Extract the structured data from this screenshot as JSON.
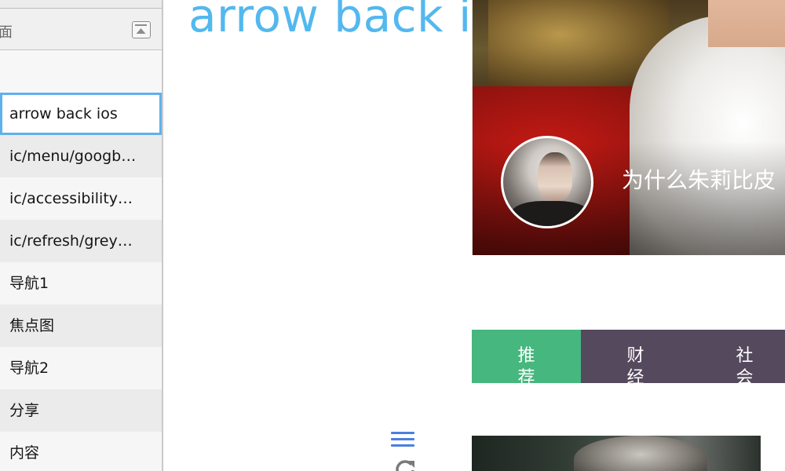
{
  "sidebar": {
    "group_label": "面",
    "layers": [
      {
        "label": "arrow back ios",
        "selected": true
      },
      {
        "label": "ic/menu/googb…",
        "selected": false
      },
      {
        "label": "ic/accessibility…",
        "selected": false
      },
      {
        "label": "ic/refresh/grey…",
        "selected": false
      },
      {
        "label": "导航1",
        "selected": false
      },
      {
        "label": "焦点图",
        "selected": false
      },
      {
        "label": "导航2",
        "selected": false
      },
      {
        "label": "分享",
        "selected": false
      },
      {
        "label": "内容",
        "selected": false
      }
    ]
  },
  "canvas": {
    "artboard_title": "arrow back ios",
    "hero": {
      "title": "为什么朱莉比皮"
    },
    "tabs": [
      {
        "label": "推荐",
        "active": true
      },
      {
        "label": "财经",
        "active": false
      },
      {
        "label": "社会",
        "active": false
      }
    ]
  },
  "colors": {
    "accent_blue": "#53b8ee",
    "tab_active": "#46b77e",
    "tab_bar": "#55495e",
    "selection_border": "#5fb1ec",
    "icon_blue": "#4a7fe0"
  },
  "icons": {
    "collapse": "collapse-icon",
    "menu": "menu-icon",
    "refresh": "refresh-icon"
  }
}
